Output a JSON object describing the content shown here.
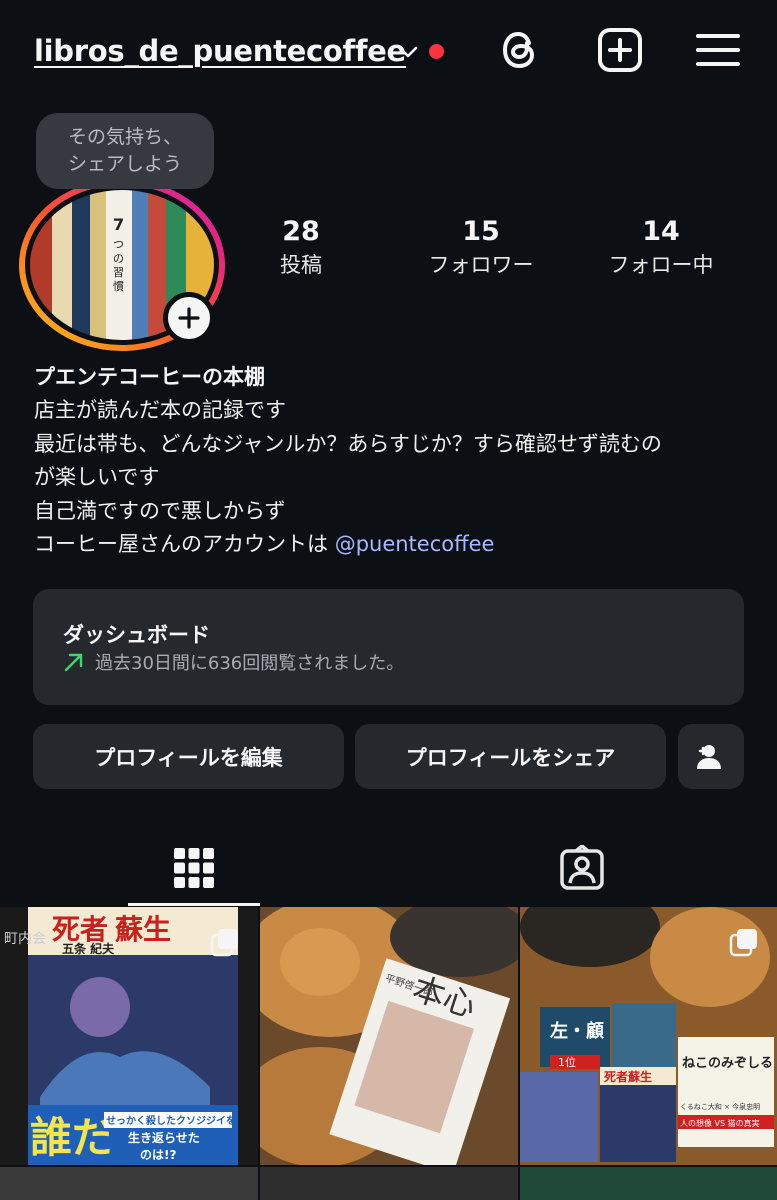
{
  "header": {
    "username": "libros_de_puentecoffee",
    "icons": [
      "chevron-down-icon",
      "threads-icon",
      "add-post-icon",
      "menu-icon"
    ]
  },
  "note": {
    "line1": "その気持ち、",
    "line2": "シェアしよう"
  },
  "stats": [
    {
      "value": "28",
      "label": "投稿"
    },
    {
      "value": "15",
      "label": "フォロワー"
    },
    {
      "value": "14",
      "label": "フォロー中"
    }
  ],
  "bio": {
    "name": "プエンテコーヒーの本棚",
    "lines": [
      "店主が読んだ本の記録です",
      "最近は帯も、どんなジャンルか？あらすじか？すら確認せず読むの",
      "が楽しいです",
      "自己満ですので悪しからず"
    ],
    "mention_prefix": "コーヒー屋さんのアカウントは ",
    "mention": "@puentecoffee"
  },
  "dashboard": {
    "title": "ダッシュボード",
    "subtitle": "過去30日間に636回閲覧されました。",
    "trend_color": "#3dd96b"
  },
  "buttons": {
    "edit": "プロフィールを編集",
    "share": "プロフィールをシェア"
  },
  "colors": {
    "background": "#0c1014",
    "surface": "#25292e",
    "accent_red": "#ff3040",
    "mention": "#a6b8ff"
  },
  "posts": {
    "post1": {
      "t1": "死者",
      "t2": "蘇生",
      "t3": "五条 紀夫",
      "t4": "町内会",
      "t5": "誰だ",
      "t6": "せっかく殺したクソジジイを",
      "t7": "生き返らせた",
      "t8": "のは!?"
    },
    "post2": {
      "t1": "本心",
      "t2": "平野啓一郎"
    },
    "post3": {
      "t1": "ねこのみぞしる",
      "t2": "左・顧",
      "t3": "死者蘇生",
      "t4": "人の想像 VS 猫の真実",
      "t5": "くるねこ大和 × 今泉忠明",
      "t6": "1位"
    }
  }
}
